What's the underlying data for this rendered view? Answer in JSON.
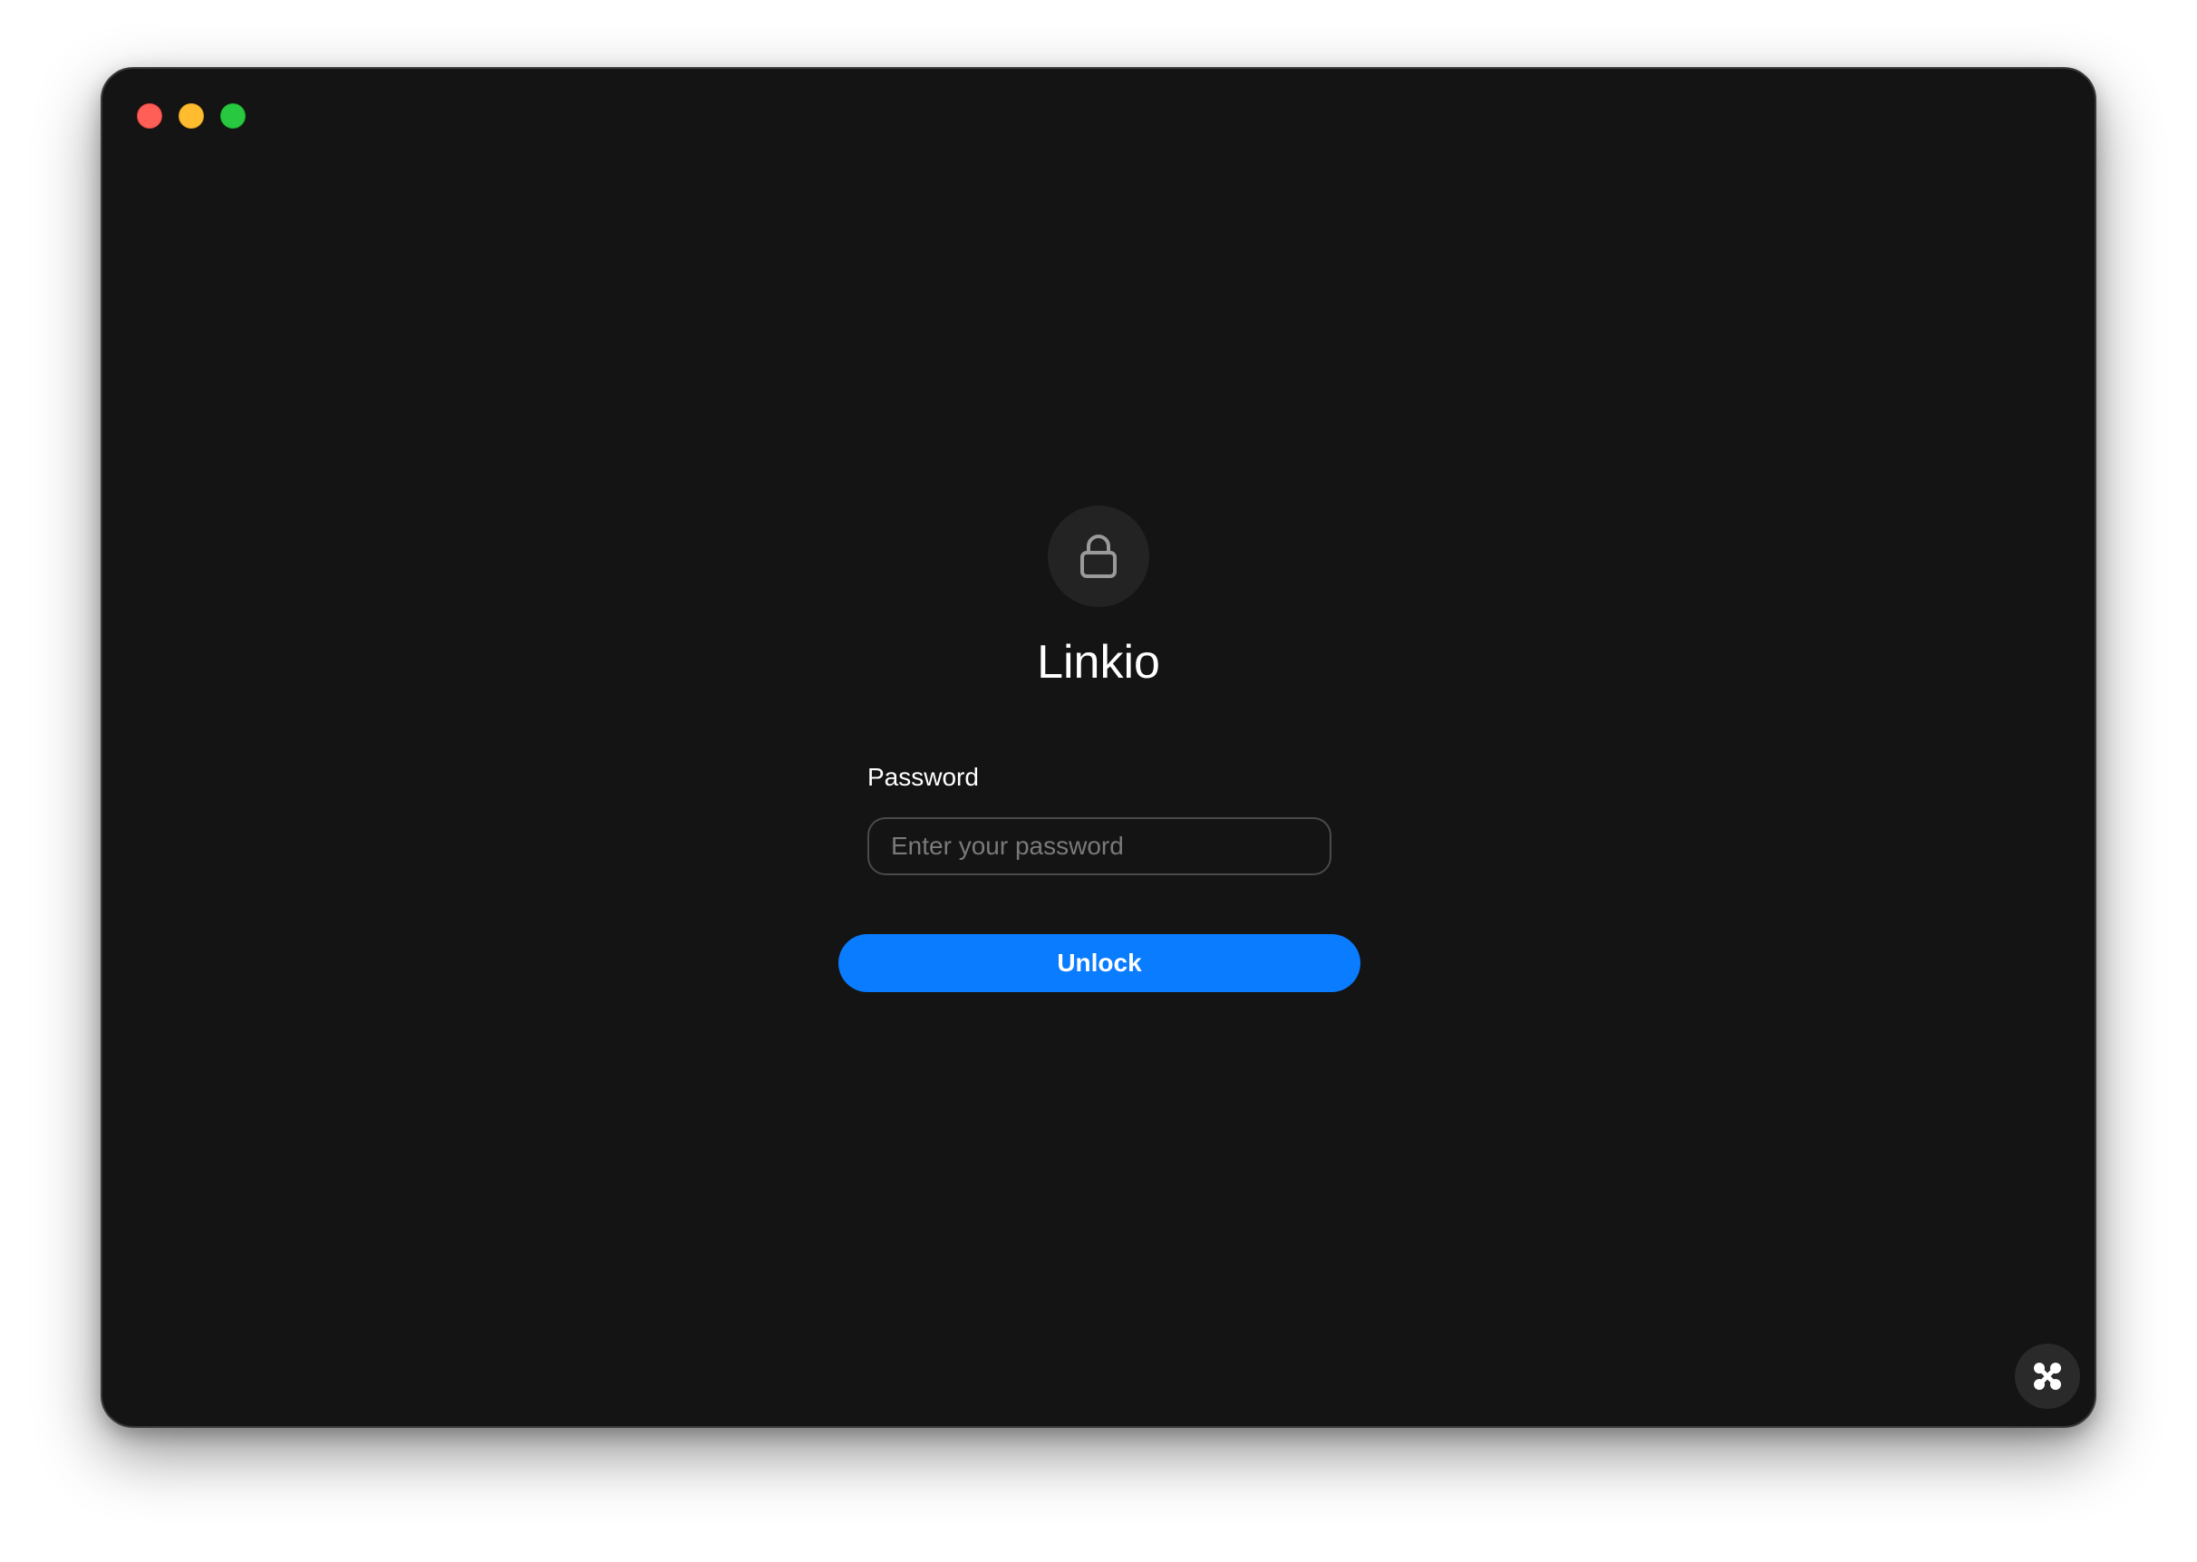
{
  "window": {
    "controls": [
      "close",
      "minimize",
      "maximize"
    ]
  },
  "lock": {
    "icon": "lock-icon"
  },
  "app": {
    "title": "Linkio"
  },
  "form": {
    "password_label": "Password",
    "password_placeholder": "Enter your password",
    "password_value": "",
    "unlock_label": "Unlock"
  },
  "corner_button": {
    "icon": "command-icon"
  },
  "colors": {
    "background": "#141414",
    "accent": "#0a7cff",
    "close": "#ff5f57",
    "minimize": "#febc2e",
    "maximize": "#28c840"
  }
}
